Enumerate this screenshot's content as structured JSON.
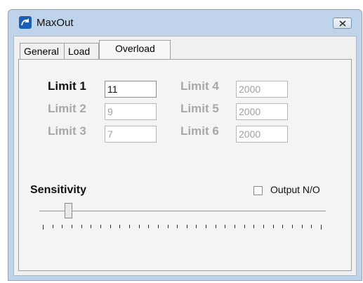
{
  "window": {
    "title": "MaxOut"
  },
  "tabs": [
    {
      "label": "General"
    },
    {
      "label": "Load"
    },
    {
      "label": "Overload"
    }
  ],
  "limits": [
    {
      "label": "Limit 1",
      "value": "11"
    },
    {
      "label": "Limit 2",
      "value": "9"
    },
    {
      "label": "Limit 3",
      "value": "7"
    },
    {
      "label": "Limit 4",
      "value": "2000"
    },
    {
      "label": "Limit 5",
      "value": "2000"
    },
    {
      "label": "Limit 6",
      "value": "2000"
    }
  ],
  "sensitivity": {
    "label": "Sensitivity",
    "level_fraction": 0.1
  },
  "output_option": {
    "label": "Output N/O",
    "checked": false
  },
  "colors": {
    "window_frame": "#bfd4ea",
    "app_icon": "#1a5fb4"
  }
}
